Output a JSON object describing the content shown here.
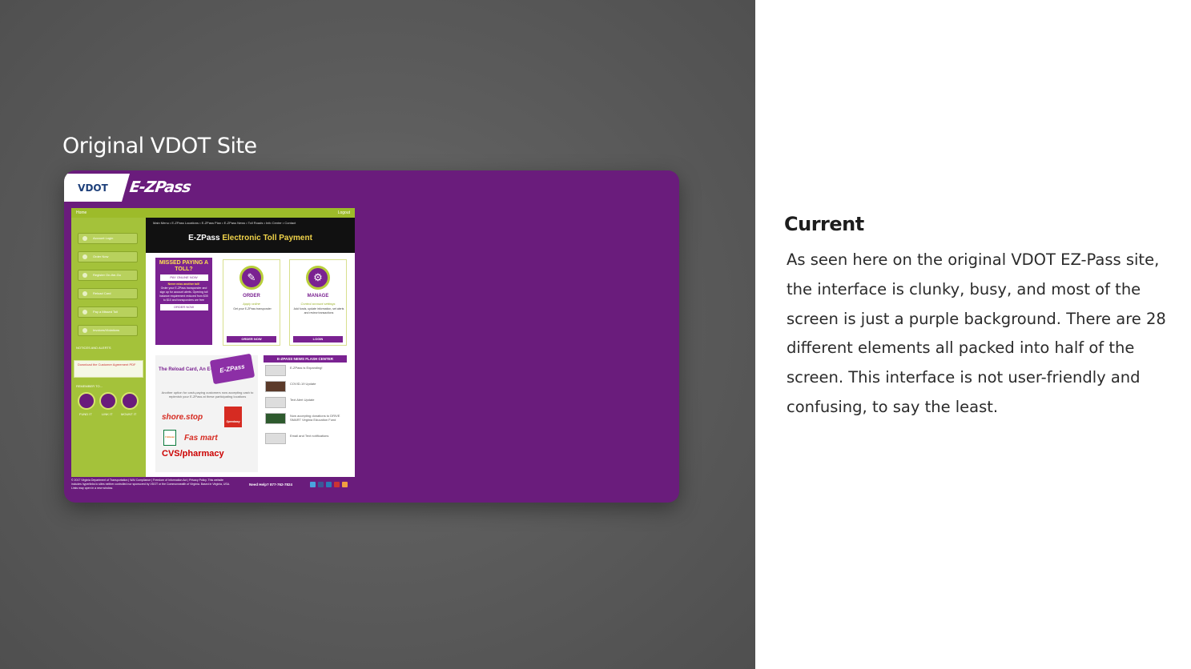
{
  "left": {
    "heading": "Original VDOT Site",
    "logo_text": "VDOT",
    "ezpass_logo": "E-ZPass"
  },
  "mini_site": {
    "top_left": "Home",
    "top_right": "Logout",
    "nav": "Main Menu  •  E-ZPass Locations  •  E-ZPass Plan  •  E-ZPass News  •  Toll Roads  •  Info Center  •  Contact",
    "banner_white": "E-ZPass ",
    "banner_yellow": "Electronic Toll Payment",
    "side_items": [
      "Account Login",
      "Order Now",
      "Register On-the-Go",
      "Reload Card",
      "Pay a Missed Toll",
      "Invoices/Violations"
    ],
    "notices": "NOTICES AND ALERTS",
    "notice_link": "Download the Customer Agreement PDF",
    "remember": "REMEMBER TO...",
    "circles": [
      "FUND IT",
      "LINK IT",
      "MOUNT IT"
    ],
    "missed": {
      "title": "MISSED PAYING A TOLL?",
      "pay": "PAY ONLINE NOW",
      "never": "Never miss another toll!",
      "text": "Order your E-ZPass transponder and sign up for account alerts. Opening toll balance requirement reduced from $35 to $10 and transponders are free",
      "order": "ORDER NOW"
    },
    "order": {
      "title": "ORDER",
      "sub": "Apply online",
      "text": "Get your E-ZPass transponder",
      "btn": "ORDER NOW"
    },
    "manage": {
      "title": "MANAGE",
      "sub": "Control account settings",
      "text": "Add funds, update information, set alerts and review transactions",
      "btn": "LOGIN"
    },
    "reload": {
      "title": "The Reload Card, An E-Z Payment Option",
      "card": "E-ZPass",
      "text": "Another option for cash-paying customers now accepting cash to replenish your E-ZPass at these participating locations",
      "brands": [
        "shore.stop",
        "Speedway",
        "7-Eleven",
        "Fas mart",
        "CVS/pharmacy"
      ]
    },
    "news": {
      "title": "E-ZPASS NEWS FLASH CENTER",
      "items": [
        "E-ZPass is Expanding!",
        "COVID-19 Update",
        "Text Alert Update",
        "Now accepting donations to DRIVE SMART Virginia Education Fund",
        "Email and Text notifications"
      ]
    },
    "footer": {
      "text": "© 2017 Virginia Department of Transportation | WAI Compliance | Freedom of Information Act | Privacy Policy. This website includes hyperlinks to sites neither controlled nor sponsored by VDOT or the Commonwealth of Virginia. Based in Virginia, USA. Links may open in a new window.",
      "help": "Need Help?   877-762-7824"
    }
  },
  "right": {
    "title": "Current",
    "body": "As seen here on the original VDOT EZ-Pass site, the interface is clunky, busy, and most of the screen is just a purple background. There are 28 different elements all packed into half of the screen. This interface is not user-friendly and confusing, to say the least."
  },
  "colors": {
    "purple": "#6a1c7c",
    "green": "#a4c23a",
    "yellow": "#f0d34a"
  }
}
